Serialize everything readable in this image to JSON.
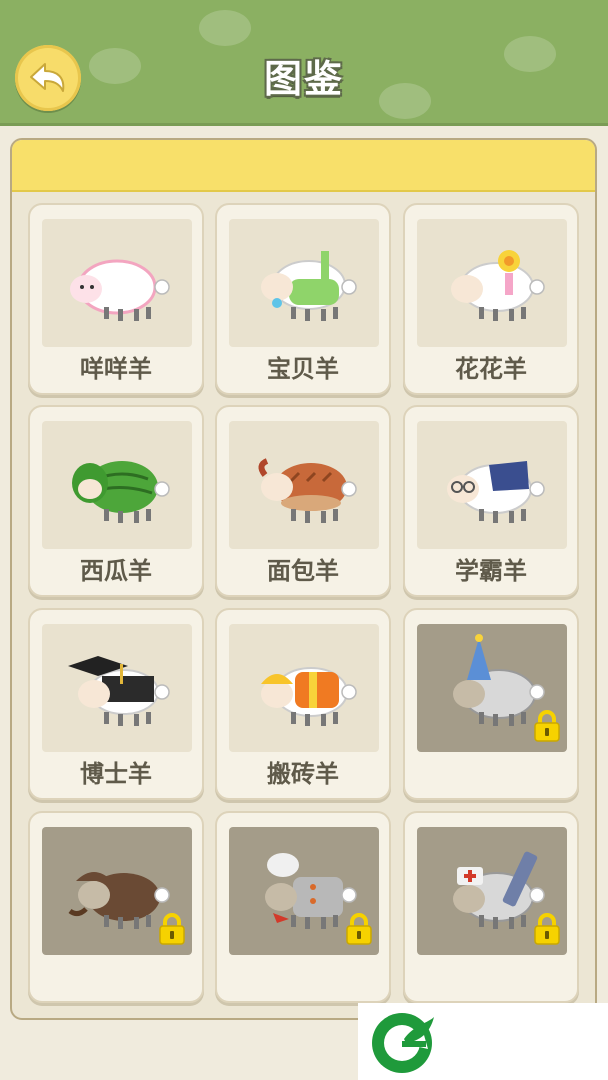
{
  "header": {
    "title": "图鉴"
  },
  "cards": [
    {
      "name": "咩咩羊",
      "locked": false,
      "costume": "pink-wool"
    },
    {
      "name": "宝贝羊",
      "locked": false,
      "costume": "green-overalls-pacifier"
    },
    {
      "name": "花花羊",
      "locked": false,
      "costume": "flower-hairclip"
    },
    {
      "name": "西瓜羊",
      "locked": false,
      "costume": "watermelon"
    },
    {
      "name": "面包羊",
      "locked": false,
      "costume": "bread"
    },
    {
      "name": "学霸羊",
      "locked": false,
      "costume": "book-glasses"
    },
    {
      "name": "博士羊",
      "locked": false,
      "costume": "graduation-cap"
    },
    {
      "name": "搬砖羊",
      "locked": false,
      "costume": "hard-hat-vest"
    },
    {
      "name": "",
      "locked": true,
      "costume": "party-hat"
    },
    {
      "name": "",
      "locked": true,
      "costume": "detective-pipe"
    },
    {
      "name": "",
      "locked": true,
      "costume": "chef-hat"
    },
    {
      "name": "",
      "locked": true,
      "costume": "nurse-syringe"
    }
  ],
  "colors": {
    "header_bg": "#8bb062",
    "panel_strip": "#f8e06a",
    "back_button": "#f7dc6a",
    "lock": "#f6d200",
    "logo": "#1f9a3b"
  },
  "icons": {
    "back": "back-arrow-icon",
    "lock": "padlock-icon",
    "logo": "brand-logo-icon"
  }
}
